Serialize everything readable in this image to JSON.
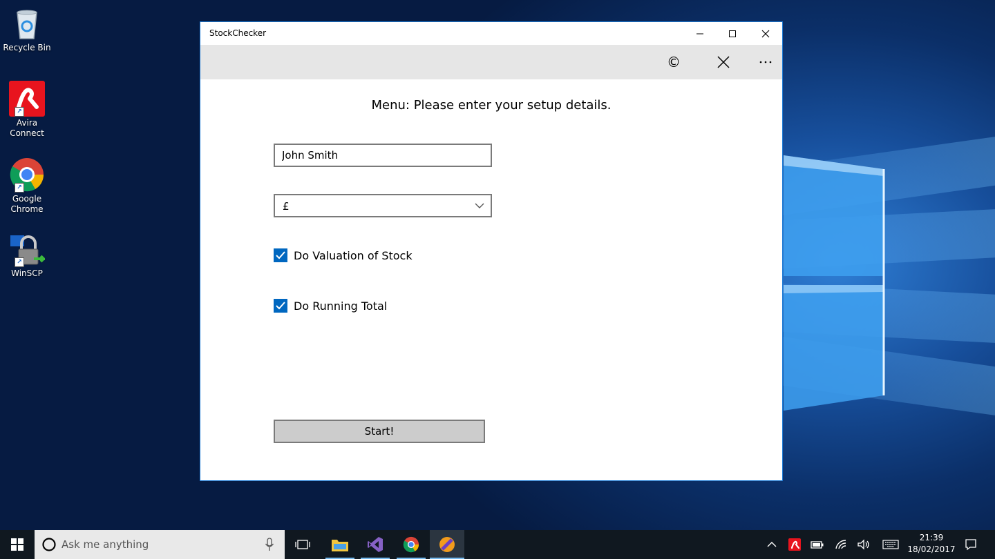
{
  "desktop": {
    "icons": [
      {
        "label": "Recycle Bin"
      },
      {
        "label": "Avira\nConnect",
        "line1": "Avira",
        "line2": "Connect"
      },
      {
        "label": "Google Chrome",
        "line1": "Google",
        "line2": "Chrome"
      },
      {
        "label": "WinSCP"
      }
    ]
  },
  "window": {
    "title": "StockChecker",
    "commands": {
      "copyright_glyph": "©"
    },
    "heading": "Menu: Please enter your setup details.",
    "name_field": {
      "value": "John Smith"
    },
    "currency_select": {
      "selected": "£"
    },
    "checkboxes": [
      {
        "label": "Do Valuation of Stock",
        "checked": true
      },
      {
        "label": "Do Running Total",
        "checked": true
      }
    ],
    "start_button": {
      "label": "Start!"
    }
  },
  "taskbar": {
    "search_placeholder": "Ask me anything",
    "clock": {
      "time": "21:39",
      "date": "18/02/2017"
    }
  },
  "colors": {
    "accent": "#0067c0",
    "window_border": "#1c7ad4",
    "command_bar": "#e6e6e6",
    "taskbar": "#101820"
  }
}
